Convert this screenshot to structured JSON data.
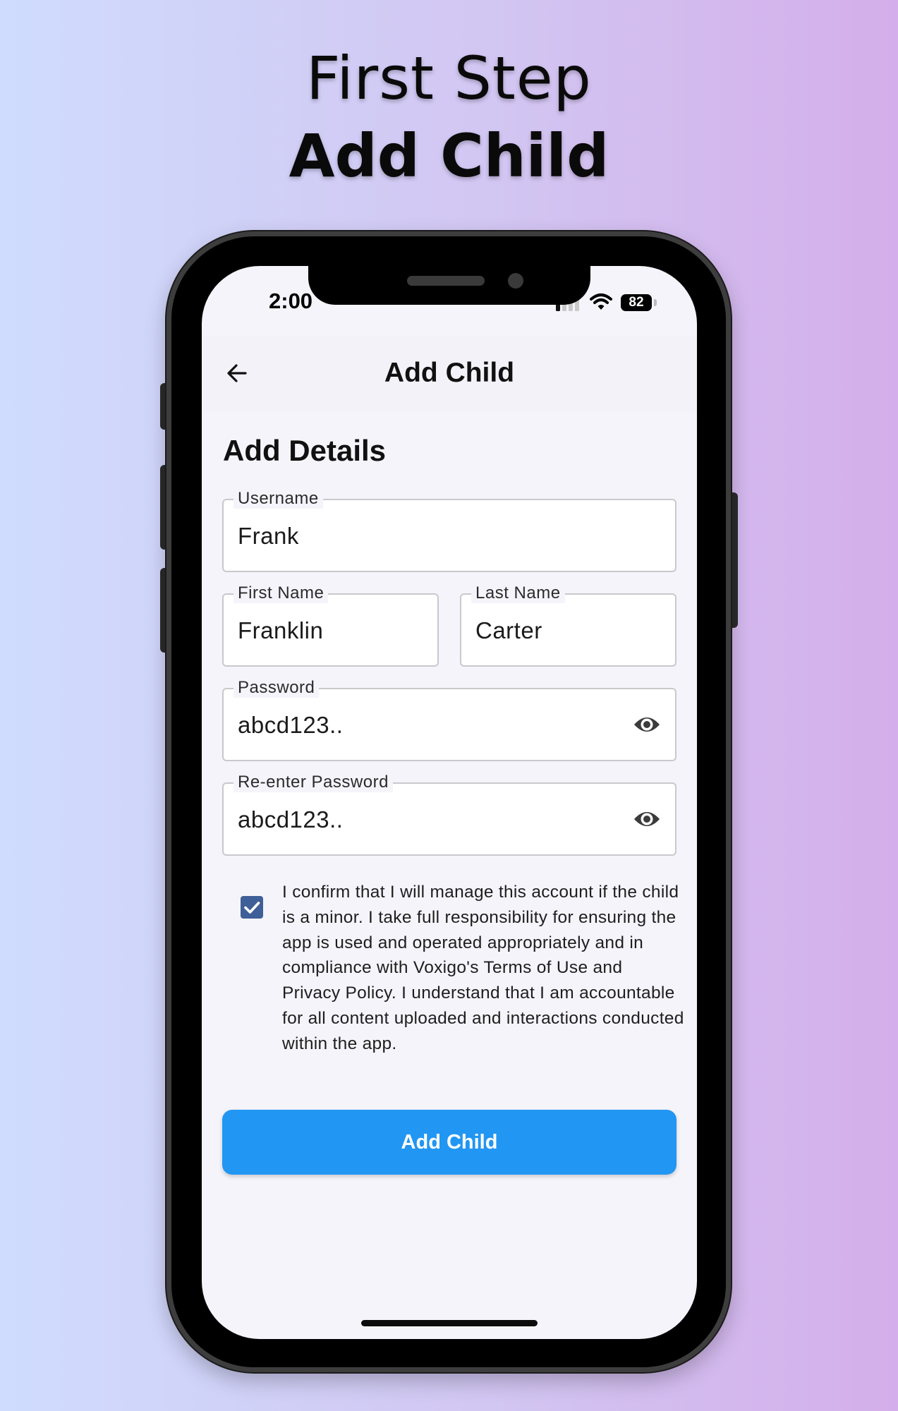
{
  "promo": {
    "line1": "First Step",
    "line2": "Add Child"
  },
  "status_bar": {
    "time": "2:00",
    "battery": "82",
    "icons": [
      "signal-icon",
      "wifi-icon",
      "battery-icon"
    ]
  },
  "app_bar": {
    "back_icon": "arrow-left-icon",
    "title": "Add Child"
  },
  "form": {
    "section_title": "Add Details",
    "username": {
      "label": "Username",
      "value": "Frank"
    },
    "first_name": {
      "label": "First Name",
      "value": "Franklin"
    },
    "last_name": {
      "label": "Last Name",
      "value": "Carter"
    },
    "password": {
      "label": "Password",
      "value": "abcd123..",
      "toggle_icon": "eye-icon"
    },
    "confirm_password": {
      "label": "Re-enter Password",
      "value": "abcd123..",
      "toggle_icon": "eye-icon"
    },
    "consent": {
      "checked": true,
      "text": "I confirm that I will manage this account if the child is a minor. I take full responsibility for ensuring the app is used and operated appropriately and in compliance with Voxigo's Terms of Use and Privacy Policy. I understand that I am accountable for all content uploaded and interactions conducted within the app."
    },
    "submit_label": "Add Child"
  },
  "colors": {
    "primary_button": "#2196f3",
    "checkbox": "#3f5f98",
    "screen_background": "#f5f4fb"
  }
}
